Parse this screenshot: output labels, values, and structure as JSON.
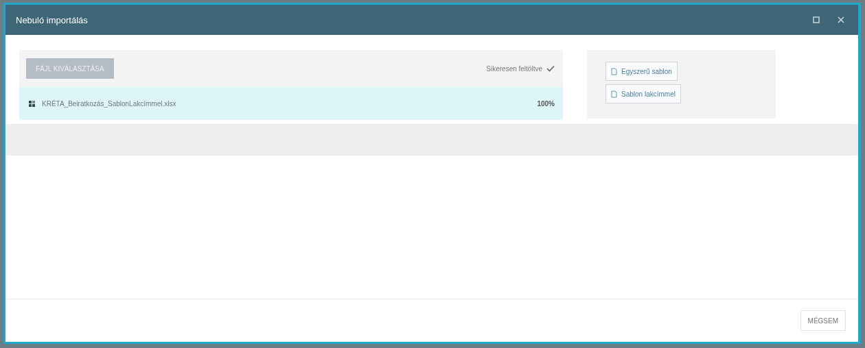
{
  "window": {
    "title": "Nebuló importálás"
  },
  "upload": {
    "choose_button": {
      "label": "FÁJL KIVÁLASZTÁSA",
      "disabled": true
    },
    "status": "Sikeresen feltöltve",
    "file": {
      "name": "KRÉTA_Beiratkozás_SablonLakcímmel.xlsx",
      "progress": "100%",
      "level": 1
    }
  },
  "templates": [
    {
      "label": "Egyszerű sablon"
    },
    {
      "label": "Sablon lakcímmel"
    }
  ],
  "footer": {
    "cancel": "MÉGSEM"
  }
}
